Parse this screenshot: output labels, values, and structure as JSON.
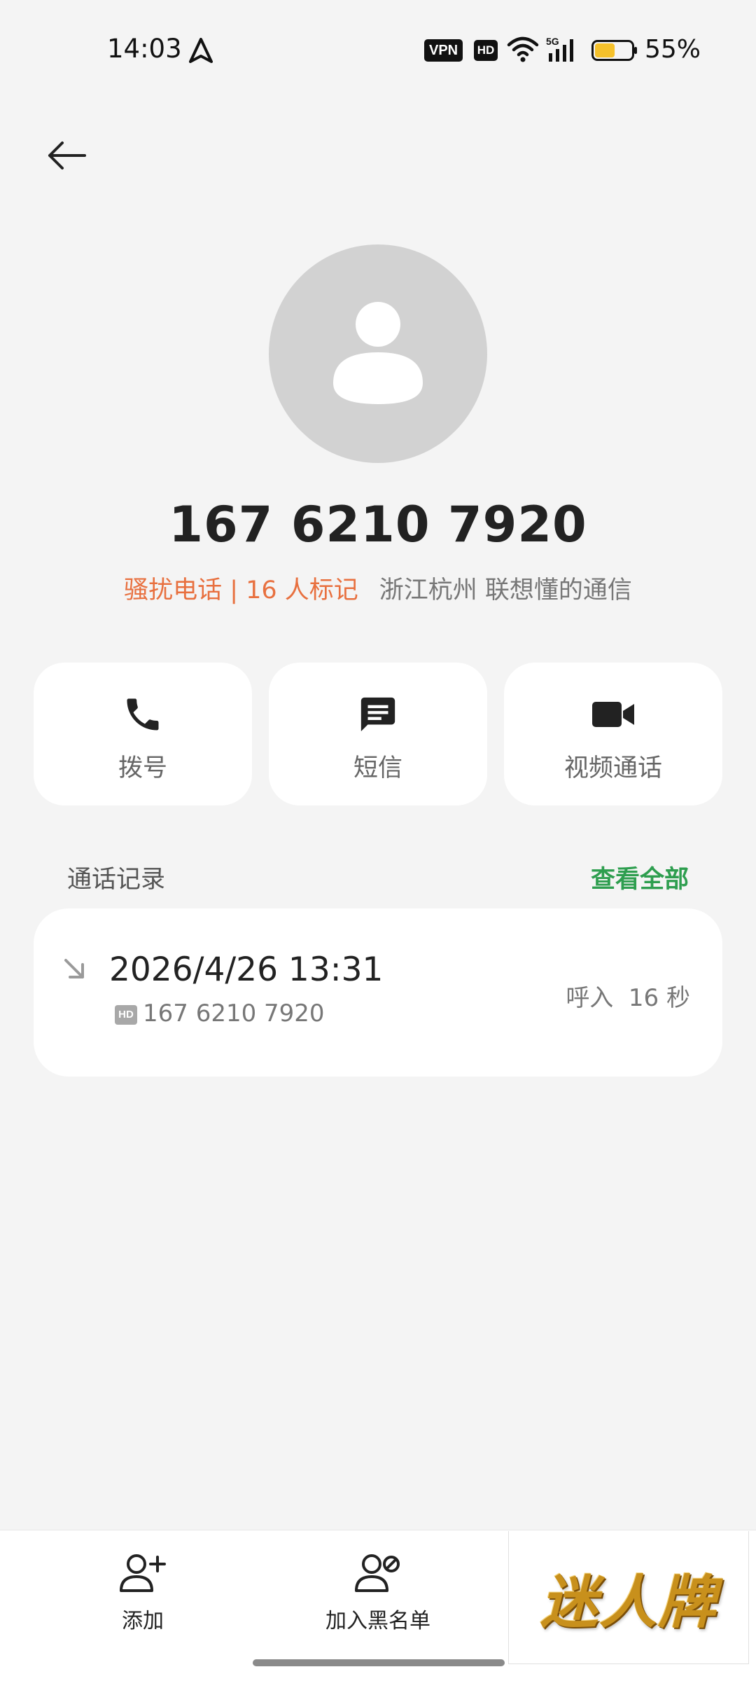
{
  "status_bar": {
    "time": "14:03",
    "vpn": "VPN",
    "hd": "HD",
    "network": "5G",
    "battery_percent": "55%",
    "battery_level": 0.55,
    "battery_color": "#f5c12b"
  },
  "contact": {
    "number": "167 6210 7920",
    "spam_label": "骚扰电话 | 16 人标记",
    "location": "浙江杭州 联想懂的通信"
  },
  "actions": {
    "call_label": "拨号",
    "sms_label": "短信",
    "video_label": "视频通话"
  },
  "call_log": {
    "title": "通话记录",
    "view_all": "查看全部",
    "records": [
      {
        "datetime": "2026/4/26 13:31",
        "hd_badge": "HD",
        "number": "167 6210 7920",
        "status": "呼入  16 秒",
        "direction_icon": "incoming-call-arrow-icon"
      }
    ]
  },
  "bottom_bar": {
    "add_label": "添加",
    "block_label": "加入黑名单"
  },
  "ad": {
    "text": "迷人牌"
  },
  "colors": {
    "accent_green": "#2e9e4f",
    "spam_orange": "#e8703f",
    "background": "#f4f4f4"
  }
}
